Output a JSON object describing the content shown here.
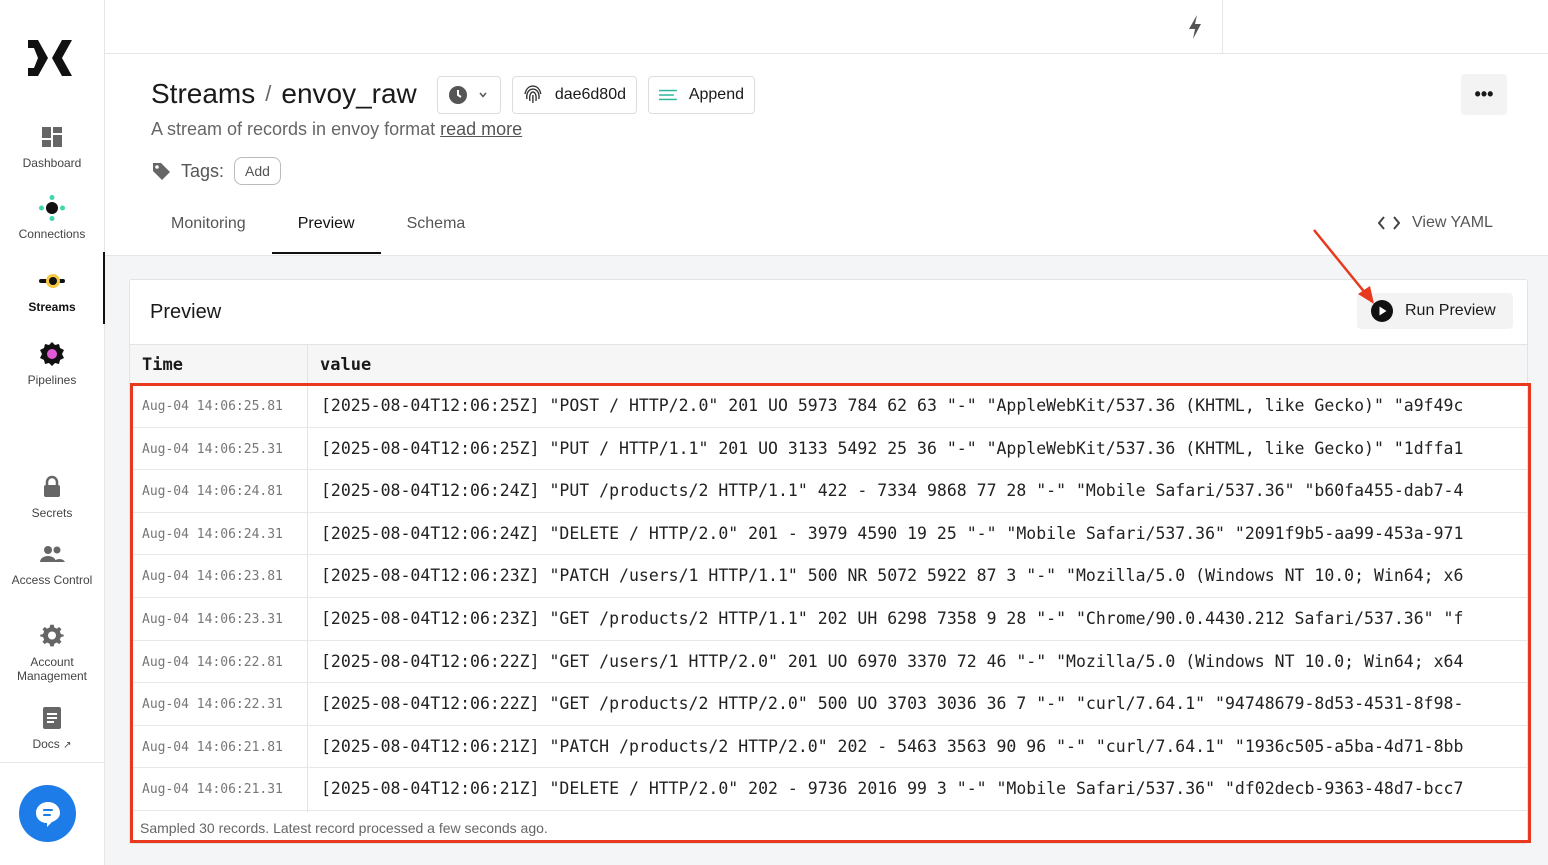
{
  "sidebar": {
    "items": [
      {
        "label": "Dashboard",
        "icon": "dashboard-icon"
      },
      {
        "label": "Connections",
        "icon": "connections-icon"
      },
      {
        "label": "Streams",
        "icon": "streams-icon",
        "active": true
      },
      {
        "label": "Pipelines",
        "icon": "pipelines-icon"
      },
      {
        "label": "Secrets",
        "icon": "lock-icon"
      },
      {
        "label": "Access Control",
        "icon": "users-icon"
      },
      {
        "label": "Account Management",
        "icon": "gear-icon"
      },
      {
        "label": "Docs",
        "icon": "document-icon"
      }
    ]
  },
  "header": {
    "breadcrumb_root": "Streams",
    "separator": "/",
    "stream_name": "envoy_raw",
    "version_hash": "dae6d80d",
    "mode_label": "Append",
    "more_label": "•••",
    "description": "A stream of records in envoy format",
    "read_more": "read more",
    "tags_label": "Tags:",
    "add_tag_label": "Add"
  },
  "tabs": [
    {
      "label": "Monitoring"
    },
    {
      "label": "Preview",
      "active": true
    },
    {
      "label": "Schema"
    }
  ],
  "view_yaml_label": "View YAML",
  "preview": {
    "title": "Preview",
    "run_button_label": "Run Preview",
    "columns": [
      "Time",
      "value"
    ],
    "rows": [
      {
        "time": "Aug-04 14:06:25.81",
        "value": "[2025-08-04T12:06:25Z] \"POST / HTTP/2.0\" 201 UO 5973 784 62 63 \"-\" \"AppleWebKit/537.36 (KHTML, like Gecko)\" \"a9f49c"
      },
      {
        "time": "Aug-04 14:06:25.31",
        "value": "[2025-08-04T12:06:25Z] \"PUT / HTTP/1.1\" 201 UO 3133 5492 25 36 \"-\" \"AppleWebKit/537.36 (KHTML, like Gecko)\" \"1dffa1"
      },
      {
        "time": "Aug-04 14:06:24.81",
        "value": "[2025-08-04T12:06:24Z] \"PUT /products/2 HTTP/1.1\" 422 - 7334 9868 77 28 \"-\" \"Mobile Safari/537.36\" \"b60fa455-dab7-4"
      },
      {
        "time": "Aug-04 14:06:24.31",
        "value": "[2025-08-04T12:06:24Z] \"DELETE / HTTP/2.0\" 201 - 3979 4590 19 25 \"-\" \"Mobile Safari/537.36\" \"2091f9b5-aa99-453a-971"
      },
      {
        "time": "Aug-04 14:06:23.81",
        "value": "[2025-08-04T12:06:23Z] \"PATCH /users/1 HTTP/1.1\" 500 NR 5072 5922 87 3 \"-\" \"Mozilla/5.0 (Windows NT 10.0; Win64; x6"
      },
      {
        "time": "Aug-04 14:06:23.31",
        "value": "[2025-08-04T12:06:23Z] \"GET /products/2 HTTP/1.1\" 202 UH 6298 7358 9 28 \"-\" \"Chrome/90.0.4430.212 Safari/537.36\" \"f"
      },
      {
        "time": "Aug-04 14:06:22.81",
        "value": "[2025-08-04T12:06:22Z] \"GET /users/1 HTTP/2.0\" 201 UO 6970 3370 72 46 \"-\" \"Mozilla/5.0 (Windows NT 10.0; Win64; x64"
      },
      {
        "time": "Aug-04 14:06:22.31",
        "value": "[2025-08-04T12:06:22Z] \"GET /products/2 HTTP/2.0\" 500 UO 3703 3036 36 7 \"-\" \"curl/7.64.1\" \"94748679-8d53-4531-8f98-"
      },
      {
        "time": "Aug-04 14:06:21.81",
        "value": "[2025-08-04T12:06:21Z] \"PATCH /products/2 HTTP/2.0\" 202 - 5463 3563 90 96 \"-\" \"curl/7.64.1\" \"1936c505-a5ba-4d71-8bb"
      },
      {
        "time": "Aug-04 14:06:21.31",
        "value": "[2025-08-04T12:06:21Z] \"DELETE / HTTP/2.0\" 202 - 9736 2016 99 3 \"-\" \"Mobile Safari/537.36\" \"df02decb-9363-48d7-bcc7"
      }
    ],
    "footer": "Sampled 30 records.  Latest record processed a few seconds ago."
  },
  "colors": {
    "accent": "#1e7ce8",
    "annotation": "#e8391f",
    "connections_teal": "#3fd6b0",
    "streams_yellow": "#f6c945",
    "pipelines_pink": "#e35ad8"
  }
}
